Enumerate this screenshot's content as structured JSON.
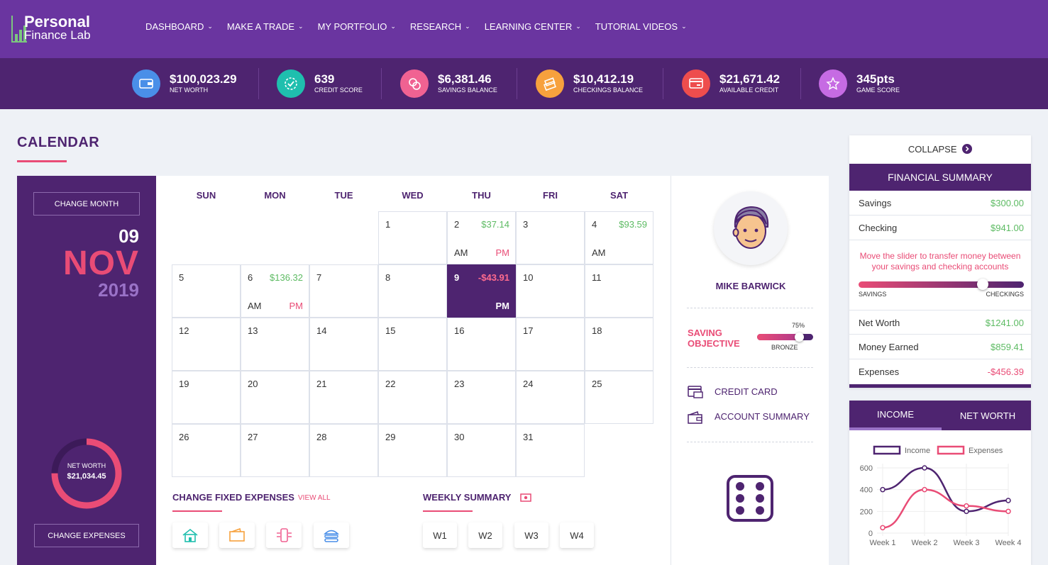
{
  "logo": {
    "line1": "Personal",
    "line2": "Finance Lab"
  },
  "nav": [
    {
      "label": "DASHBOARD"
    },
    {
      "label": "MAKE A TRADE"
    },
    {
      "label": "MY PORTFOLIO"
    },
    {
      "label": "RESEARCH"
    },
    {
      "label": "LEARNING CENTER"
    },
    {
      "label": "TUTORIAL VIDEOS"
    }
  ],
  "stats": [
    {
      "value": "$100,023.29",
      "label": "NET WORTH",
      "icon": "wallet-icon",
      "color": "#4a8fe8"
    },
    {
      "value": "639",
      "label": "CREDIT SCORE",
      "icon": "badge-check-icon",
      "color": "#1fbfae"
    },
    {
      "value": "$6,381.46",
      "label": "SAVINGS BALANCE",
      "icon": "coins-icon",
      "color": "#f06292"
    },
    {
      "value": "$10,412.19",
      "label": "CHECKINGS BALANCE",
      "icon": "cash-stack-icon",
      "color": "#f7a13d"
    },
    {
      "value": "$21,671.42",
      "label": "AVAILABLE CREDIT",
      "icon": "credit-card-icon",
      "color": "#ee4d4d"
    },
    {
      "value": "345pts",
      "label": "GAME SCORE",
      "icon": "star-icon",
      "color": "#c66be3"
    }
  ],
  "page": {
    "title": "CALENDAR"
  },
  "date_panel": {
    "change_month": "CHANGE MONTH",
    "day": "09",
    "month": "NOV",
    "year": "2019",
    "net_worth_label": "NET WORTH",
    "net_worth_value": "$21,034.45",
    "net_worth_fraction": 0.75,
    "change_expenses": "CHANGE EXPENSES"
  },
  "calendar": {
    "days_of_week": [
      "SUN",
      "MON",
      "TUE",
      "WED",
      "THU",
      "FRI",
      "SAT"
    ],
    "first_weekday": 3,
    "days_in_month": 31,
    "active_day": 9,
    "entries": {
      "2": {
        "amount": "$37.14",
        "am": "AM",
        "pm": "PM"
      },
      "4": {
        "amount": "$93.59",
        "am": "AM"
      },
      "6": {
        "amount": "$136.32",
        "am": "AM",
        "pm": "PM"
      },
      "9": {
        "amount": "-$43.91",
        "pm": "PM"
      }
    }
  },
  "fixed_expenses": {
    "title": "CHANGE FIXED EXPENSES",
    "view_all": "VIEW ALL"
  },
  "weekly_summary": {
    "title": "WEEKLY SUMMARY",
    "weeks": [
      "W1",
      "W2",
      "W3",
      "W4"
    ]
  },
  "profile": {
    "name": "MIKE BARWICK",
    "saving_objective_line1": "SAVING",
    "saving_objective_line2": "OBJECTIVE",
    "objective_percent": "75%",
    "objective_fraction": 0.75,
    "objective_tier": "BRONZE",
    "links": [
      "CREDIT CARD",
      "ACCOUNT SUMMARY"
    ]
  },
  "sidebar": {
    "collapse": "COLLAPSE",
    "summary_title": "FINANCIAL SUMMARY",
    "rows_top": [
      {
        "label": "Savings",
        "value": "$300.00"
      },
      {
        "label": "Checking",
        "value": "$941.00"
      }
    ],
    "slider_message": "Move the slider to transfer money between your savings and checking accounts",
    "slider_left": "SAVINGS",
    "slider_right": "CHECKINGS",
    "slider_fraction": 0.75,
    "rows_bottom": [
      {
        "label": "Net Worth",
        "value": "$1241.00"
      },
      {
        "label": "Money Earned",
        "value": "$859.41"
      },
      {
        "label": "Expenses",
        "value": "-$456.39"
      }
    ]
  },
  "chart_tabs": [
    "INCOME",
    "NET WORTH"
  ],
  "chart_data": {
    "type": "line",
    "categories": [
      "Week 1",
      "Week 2",
      "Week 3",
      "Week 4"
    ],
    "series": [
      {
        "name": "Income",
        "values": [
          400,
          600,
          200,
          300
        ],
        "color": "#4e2470"
      },
      {
        "name": "Expenses",
        "values": [
          50,
          400,
          250,
          200
        ],
        "color": "#e94c76"
      }
    ],
    "yticks": [
      0,
      200,
      400,
      600
    ],
    "ylim": [
      0,
      600
    ],
    "legend": "top"
  }
}
